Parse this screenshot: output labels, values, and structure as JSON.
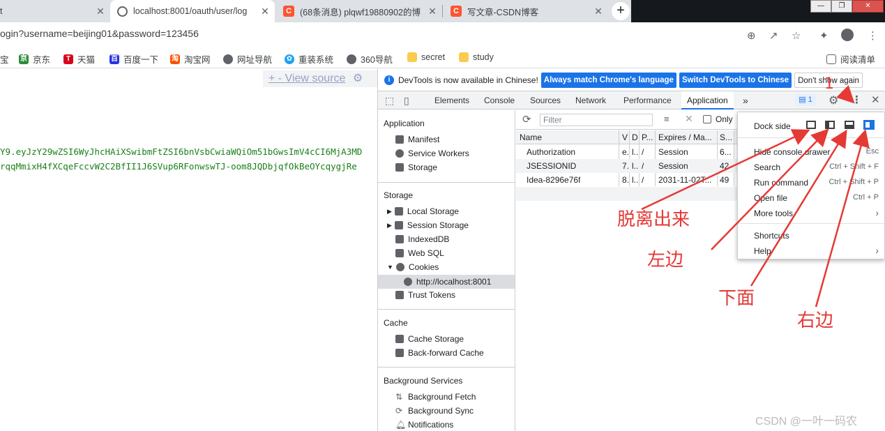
{
  "browser": {
    "tabs": [
      {
        "title": "t",
        "active": false
      },
      {
        "title": "localhost:8001/oauth/user/log",
        "active": true
      },
      {
        "title": "(68条消息) plqwf19880902的博",
        "active": false
      },
      {
        "title": "写文章-CSDN博客",
        "active": false
      }
    ],
    "new_tab": "+",
    "url": "ogin?username=beijing01&password=123456",
    "bookmarks": [
      "宝",
      "京东",
      "天猫",
      "百度一下",
      "淘宝网",
      "网址导航",
      "重装系统",
      "360导航",
      "secret",
      "study"
    ],
    "reading_list": "阅读清单"
  },
  "page": {
    "source_bar": "+  -  View source",
    "jwt_line1": "Y9.eyJzY29wZSI6WyJhcHAiXSwibmFtZSI6bnVsbCwiaWQiOm51bGwsImV4cCI6MjA3MD",
    "jwt_line2": "rqqMmixH4fXCqeFccvW2C2BfII1J6SVup6RFonwswTJ-oom8JQDbjqfOkBeOYcqygjRe"
  },
  "devtools": {
    "infobar": {
      "message": "DevTools is now available in Chinese!",
      "btn_always": "Always match Chrome's language",
      "btn_switch": "Switch DevTools to Chinese",
      "btn_dont": "Don't show again"
    },
    "tabs": [
      "Elements",
      "Console",
      "Sources",
      "Network",
      "Performance",
      "Application"
    ],
    "more": "»",
    "issues_count": "1",
    "sidebar": {
      "application_header": "Application",
      "application_items": [
        "Manifest",
        "Service Workers",
        "Storage"
      ],
      "storage_header": "Storage",
      "storage_items": [
        "Local Storage",
        "Session Storage",
        "IndexedDB",
        "Web SQL",
        "Cookies",
        "http://localhost:8001",
        "Trust Tokens"
      ],
      "cache_header": "Cache",
      "cache_items": [
        "Cache Storage",
        "Back-forward Cache"
      ],
      "bg_header": "Background Services",
      "bg_items": [
        "Background Fetch",
        "Background Sync",
        "Notifications"
      ]
    },
    "filter_placeholder": "Filter",
    "only_label": "Only",
    "columns": [
      "Name",
      "V",
      "D",
      "P...",
      "Expires / Ma...",
      "S...",
      "..."
    ],
    "rows": [
      [
        "Authorization",
        "e.",
        "l..",
        "/",
        "Session",
        "6..."
      ],
      [
        "JSESSIONID",
        "7.",
        "l..",
        "/",
        "Session",
        "42"
      ],
      [
        "Idea-8296e76f",
        "8.",
        "l..",
        "/",
        "2031-11-02T...",
        "49"
      ]
    ]
  },
  "menu": {
    "dock_side": "Dock side",
    "items": [
      {
        "label": "Hide console drawer",
        "shortcut": "Esc"
      },
      {
        "label": "Search",
        "shortcut": "Ctrl + Shift + F"
      },
      {
        "label": "Run command",
        "shortcut": "Ctrl + Shift + P"
      },
      {
        "label": "Open file",
        "shortcut": "Ctrl + P"
      },
      {
        "label": "More tools",
        "shortcut": "›"
      },
      {
        "label": "Shortcuts",
        "shortcut": ""
      },
      {
        "label": "Help",
        "shortcut": "›"
      }
    ]
  },
  "annotations": {
    "number": "1",
    "undock": "脱离出来",
    "left": "左边",
    "bottom": "下面",
    "right": "右边"
  },
  "watermark": "CSDN @一叶一码农",
  "colors": {
    "accent": "#1a73e8",
    "annotation": "#e53935",
    "csdn": "#fc5531",
    "jwt": "#1a7f1a"
  }
}
